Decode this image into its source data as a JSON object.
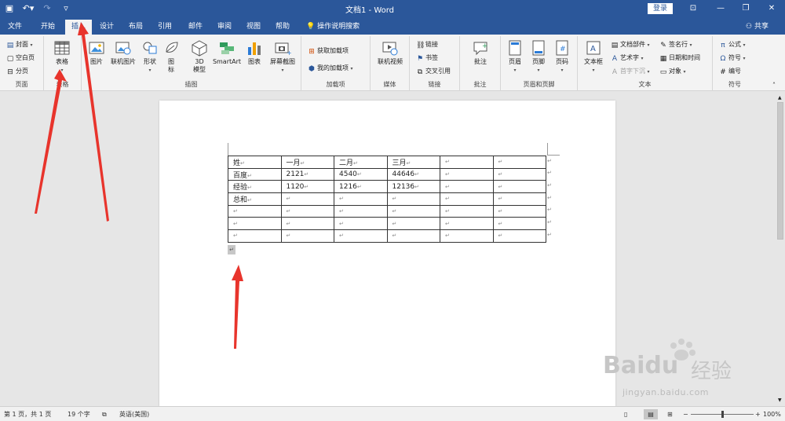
{
  "titlebar": {
    "title": "文档1 - Word",
    "login": "登录"
  },
  "tabs": [
    {
      "label": "文件"
    },
    {
      "label": "开始"
    },
    {
      "label": "插入"
    },
    {
      "label": "设计"
    },
    {
      "label": "布局"
    },
    {
      "label": "引用"
    },
    {
      "label": "邮件"
    },
    {
      "label": "审阅"
    },
    {
      "label": "视图"
    },
    {
      "label": "帮助"
    }
  ],
  "tell_me": "操作说明搜索",
  "share": "共享",
  "ribbon": {
    "pages": {
      "cover": "封面",
      "blank": "空白页",
      "break": "分页",
      "label": "页面"
    },
    "tables": {
      "table": "表格",
      "label": "表格"
    },
    "illustrations": {
      "picture": "图片",
      "online_picture": "联机图片",
      "shapes": "形状",
      "icons": "图\n标",
      "model3d": "3D\n模型",
      "smartart": "SmartArt",
      "chart": "图表",
      "screenshot": "屏幕截图",
      "label": "插图"
    },
    "addins": {
      "get": "获取加载项",
      "my": "我的加载项",
      "label": "加载项"
    },
    "media": {
      "online_video": "联机视频",
      "label": "媒体"
    },
    "links": {
      "link": "链接",
      "bookmark": "书签",
      "crossref": "交叉引用",
      "label": "链接"
    },
    "comments": {
      "comment": "批注",
      "label": "批注"
    },
    "header_footer": {
      "header": "页眉",
      "footer": "页脚",
      "page_number": "页码",
      "label": "页眉和页脚"
    },
    "text": {
      "textbox": "文本框",
      "quickparts": "文档部件",
      "wordart": "艺术字",
      "dropcap": "首字下沉",
      "signature": "签名行",
      "datetime": "日期和时间",
      "object": "对象",
      "label": "文本"
    },
    "symbols": {
      "equation": "公式",
      "symbol": "符号",
      "number": "编号",
      "label": "符号"
    }
  },
  "document": {
    "table": [
      [
        "姓",
        "一月",
        "二月",
        "三月",
        "",
        ""
      ],
      [
        "百度",
        "2121",
        "4540",
        "44646",
        "",
        ""
      ],
      [
        "经验",
        "1120",
        "1216",
        "12136",
        "",
        ""
      ],
      [
        "总和",
        "",
        "",
        "",
        "",
        ""
      ],
      [
        "",
        "",
        "",
        "",
        "",
        ""
      ],
      [
        "",
        "",
        "",
        "",
        "",
        ""
      ],
      [
        "",
        "",
        "",
        "",
        "",
        ""
      ]
    ],
    "para_mark": "↵"
  },
  "statusbar": {
    "page": "第 1 页，共 1 页",
    "words": "19 个字",
    "language": "英语(美国)",
    "zoom": "100%",
    "zoom_fraction": 0.5
  },
  "watermark": {
    "big": "Bai",
    "du": "du",
    "cn": "经验",
    "url": "jingyan.baidu.com"
  },
  "colors": {
    "accent": "#2b579a",
    "arrow": "#e8342c"
  }
}
